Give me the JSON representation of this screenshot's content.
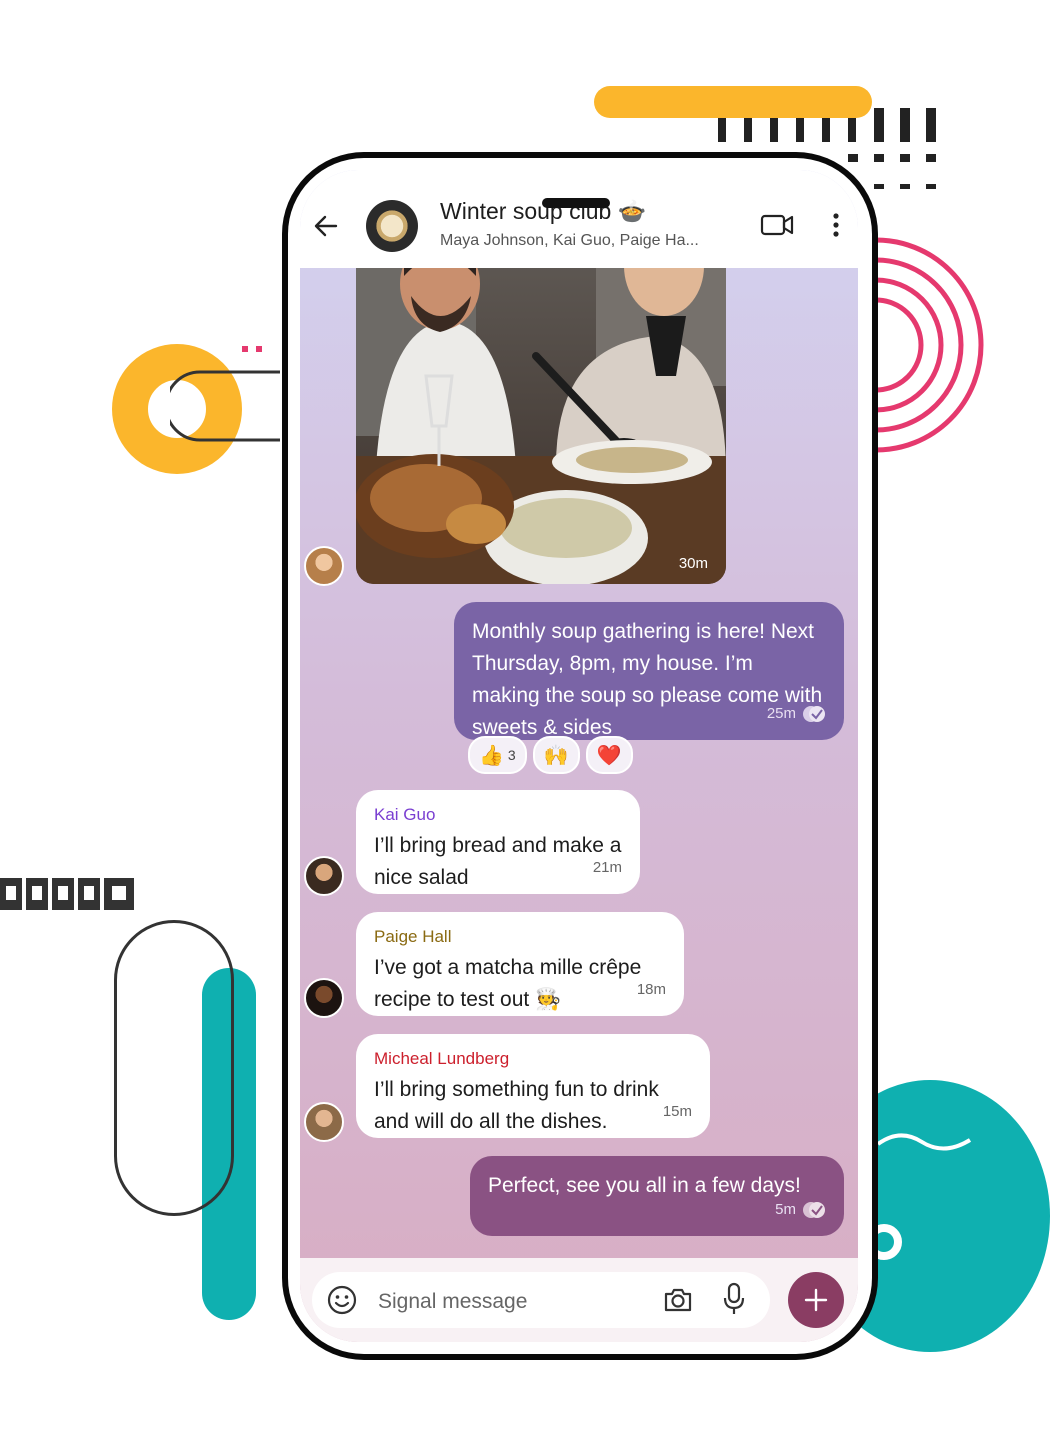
{
  "colors": {
    "accent_yellow": "#fbb62c",
    "accent_pink": "#e5396e",
    "accent_teal": "#0fb0b0",
    "outgoing_bubble_1": "#7a64a6",
    "outgoing_bubble_2": "#8a5283",
    "send_button": "#8a3d63"
  },
  "header": {
    "title": "Winter soup club 🍲",
    "subtitle": "Maya Johnson, Kai Guo, Paige Ha...",
    "icons": [
      "back-arrow-icon",
      "video-call-icon",
      "more-vertical-icon"
    ]
  },
  "messages": {
    "photo": {
      "time": "30m"
    },
    "announcement": {
      "text": "Monthly soup gathering is here! Next Thursday, 8pm, my house. I’m making the soup so please come with sweets & sides",
      "time": "25m",
      "reactions": [
        {
          "emoji": "👍",
          "count": "3"
        },
        {
          "emoji": "🙌",
          "count": ""
        },
        {
          "emoji": "❤️",
          "count": ""
        }
      ]
    },
    "kai": {
      "sender": "Kai Guo",
      "sender_color": "#7a3fd1",
      "text": "I’ll bring bread and make a nice salad",
      "time": "21m"
    },
    "paige": {
      "sender": "Paige Hall",
      "sender_color": "#8a6a12",
      "text": "I’ve got a matcha mille crêpe recipe to test out 🧑‍🍳",
      "time": "18m"
    },
    "micheal": {
      "sender": "Micheal Lundberg",
      "sender_color": "#cc1f2c",
      "text": "I’ll bring something fun to drink and will do all the dishes.",
      "time": "15m"
    },
    "final": {
      "text": "Perfect, see you all in a few days!",
      "time": "5m"
    }
  },
  "composer": {
    "placeholder": "Signal message",
    "icons": [
      "emoji-icon",
      "camera-icon",
      "microphone-icon",
      "plus-icon"
    ]
  }
}
